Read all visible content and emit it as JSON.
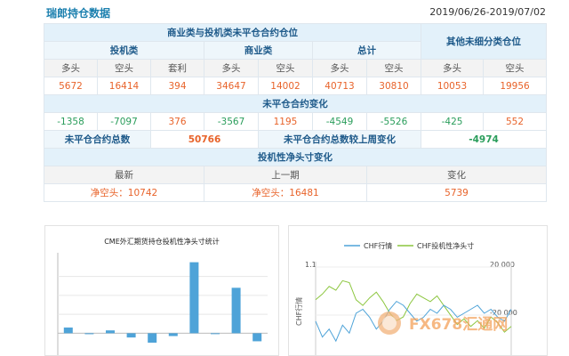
{
  "header": {
    "title": "瑞郎持仓数据",
    "date_range": "2019/06/26-2019/07/02"
  },
  "table": {
    "group1_header": "商业类与投机类未平仓合约仓位",
    "group2_header": "其他未细分类仓位",
    "speculative": "投机类",
    "commercial": "商业类",
    "total": "总计",
    "long": "多头",
    "short": "空头",
    "spread": "套利",
    "positions": [
      "5672",
      "16414",
      "394",
      "34647",
      "14002",
      "40713",
      "30810",
      "10053",
      "19956"
    ],
    "change_header": "未平仓合约变化",
    "changes": [
      "-1358",
      "-7097",
      "376",
      "-3567",
      "1195",
      "-4549",
      "-5526",
      "-425",
      "552"
    ],
    "oi_total_label": "未平仓合约总数",
    "oi_total_value": "50766",
    "oi_weekly_label": "未平仓合约总数较上周变化",
    "oi_weekly_value": "-4974",
    "net_header": "投机性净头寸变化",
    "latest": "最新",
    "previous": "上一期",
    "change": "变化",
    "latest_value": "净空头：10742",
    "previous_value": "净空头：16481",
    "change_value": "5739"
  },
  "left_chart": {
    "title": "CME外汇期货持仓投机性净头寸统计",
    "chart_data": {
      "type": "bar",
      "values": [
        600,
        -100,
        300,
        -450,
        -1000,
        -300,
        7500,
        -60,
        4800,
        -850
      ],
      "ylim": [
        -2500,
        8500
      ],
      "color": "#4ea3d8"
    }
  },
  "right_chart": {
    "legend_chf": "CHF行情",
    "legend_net": "CHF投机性净头寸",
    "y_left_top": "1.1",
    "y_right_top": "20 000",
    "y_right_mid": "-20 000",
    "y_left_label": "CHF行情",
    "chf_color": "#4ea3d8",
    "net_color": "#8cc63f",
    "chart_data": {
      "type": "line",
      "series": [
        {
          "name": "CHF行情",
          "values": [
            0.97,
            0.93,
            0.95,
            0.92,
            0.96,
            0.94,
            0.99,
            1.0,
            0.98,
            0.95,
            0.97,
            1.0,
            1.02,
            1.01,
            0.99,
            0.97,
            0.98,
            1.0,
            0.99,
            1.01,
            1.0,
            0.98,
            0.99,
            1.0,
            1.01,
            0.99,
            1.0,
            0.98,
            0.97,
            1.0
          ]
        },
        {
          "name": "CHF投机性净头寸",
          "values": [
            5000,
            8000,
            12000,
            10000,
            15000,
            14000,
            5000,
            2000,
            6000,
            9000,
            4000,
            -2000,
            -6000,
            -4000,
            3000,
            8000,
            6000,
            4000,
            7000,
            2000,
            -3000,
            -8000,
            -5000,
            -9000,
            -6000,
            -10000,
            -4000,
            -7000,
            -12000,
            -9000
          ]
        }
      ]
    }
  },
  "watermark": "FX678汇通网"
}
